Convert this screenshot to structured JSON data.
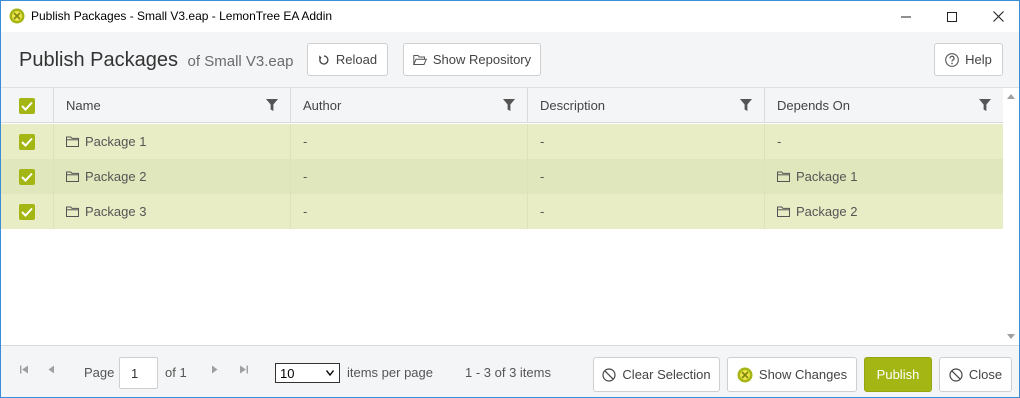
{
  "window": {
    "title": "Publish Packages - Small V3.eap - LemonTree EA Addin",
    "accent_color": "#a4b614"
  },
  "header": {
    "title": "Publish Packages",
    "subtitle": "of Small V3.eap",
    "reload_label": "Reload",
    "show_repository_label": "Show Repository",
    "help_label": "Help"
  },
  "grid": {
    "columns": [
      "Name",
      "Author",
      "Description",
      "Depends On"
    ],
    "rows": [
      {
        "checked": true,
        "name": "Package 1",
        "author": "-",
        "description": "-",
        "depends_on": "-"
      },
      {
        "checked": true,
        "name": "Package 2",
        "author": "-",
        "description": "-",
        "depends_on": "Package 1"
      },
      {
        "checked": true,
        "name": "Package 3",
        "author": "-",
        "description": "-",
        "depends_on": "Package 2"
      }
    ]
  },
  "footer": {
    "page_label": "Page",
    "page_value": "1",
    "of_label": "of 1",
    "page_size": "10",
    "items_per_page_label": "items per page",
    "range_label": "1 - 3 of 3 items",
    "clear_selection_label": "Clear Selection",
    "show_changes_label": "Show Changes",
    "publish_label": "Publish",
    "close_label": "Close"
  }
}
